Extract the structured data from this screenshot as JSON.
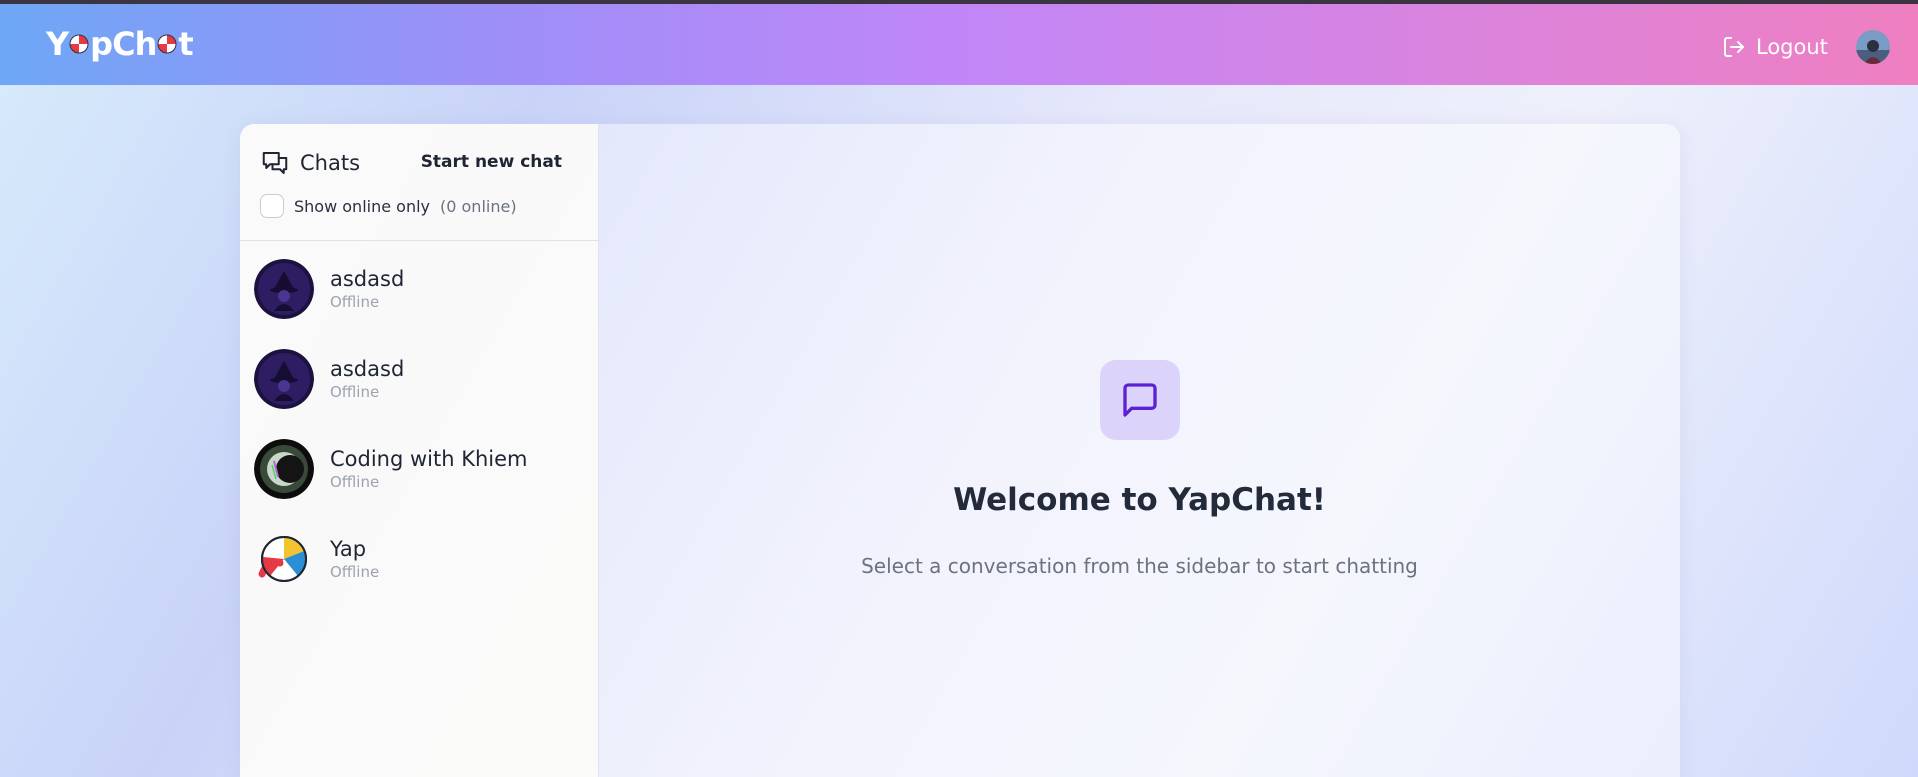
{
  "app": {
    "name": "YapChat"
  },
  "navbar": {
    "logo_text_start": "Y",
    "logo_text_mid": "pCh",
    "logo_text_end": "t",
    "logout_label": "Logout"
  },
  "sidebar": {
    "title": "Chats",
    "new_chat_label": "Start new chat",
    "online_filter_label": "Show online only",
    "online_count": "(0 online)",
    "contacts": [
      {
        "name": "asdasd",
        "status": "Offline",
        "avatar": "wizard-avatar"
      },
      {
        "name": "asdasd",
        "status": "Offline",
        "avatar": "wizard-avatar"
      },
      {
        "name": "Coding with Khiem",
        "status": "Offline",
        "avatar": "glitch-moon-avatar"
      },
      {
        "name": "Yap",
        "status": "Offline",
        "avatar": "beach-ball-avatar"
      }
    ]
  },
  "main": {
    "welcome_title": "Welcome to YapChat!",
    "welcome_subtitle": "Select a conversation from the sidebar to start chatting"
  },
  "colors": {
    "navbar_gradient": [
      "#6ea7f6",
      "#c186f7",
      "#ef7fc0"
    ],
    "accent": "#5b21d6",
    "icon_bg": "#dcd3fb"
  }
}
